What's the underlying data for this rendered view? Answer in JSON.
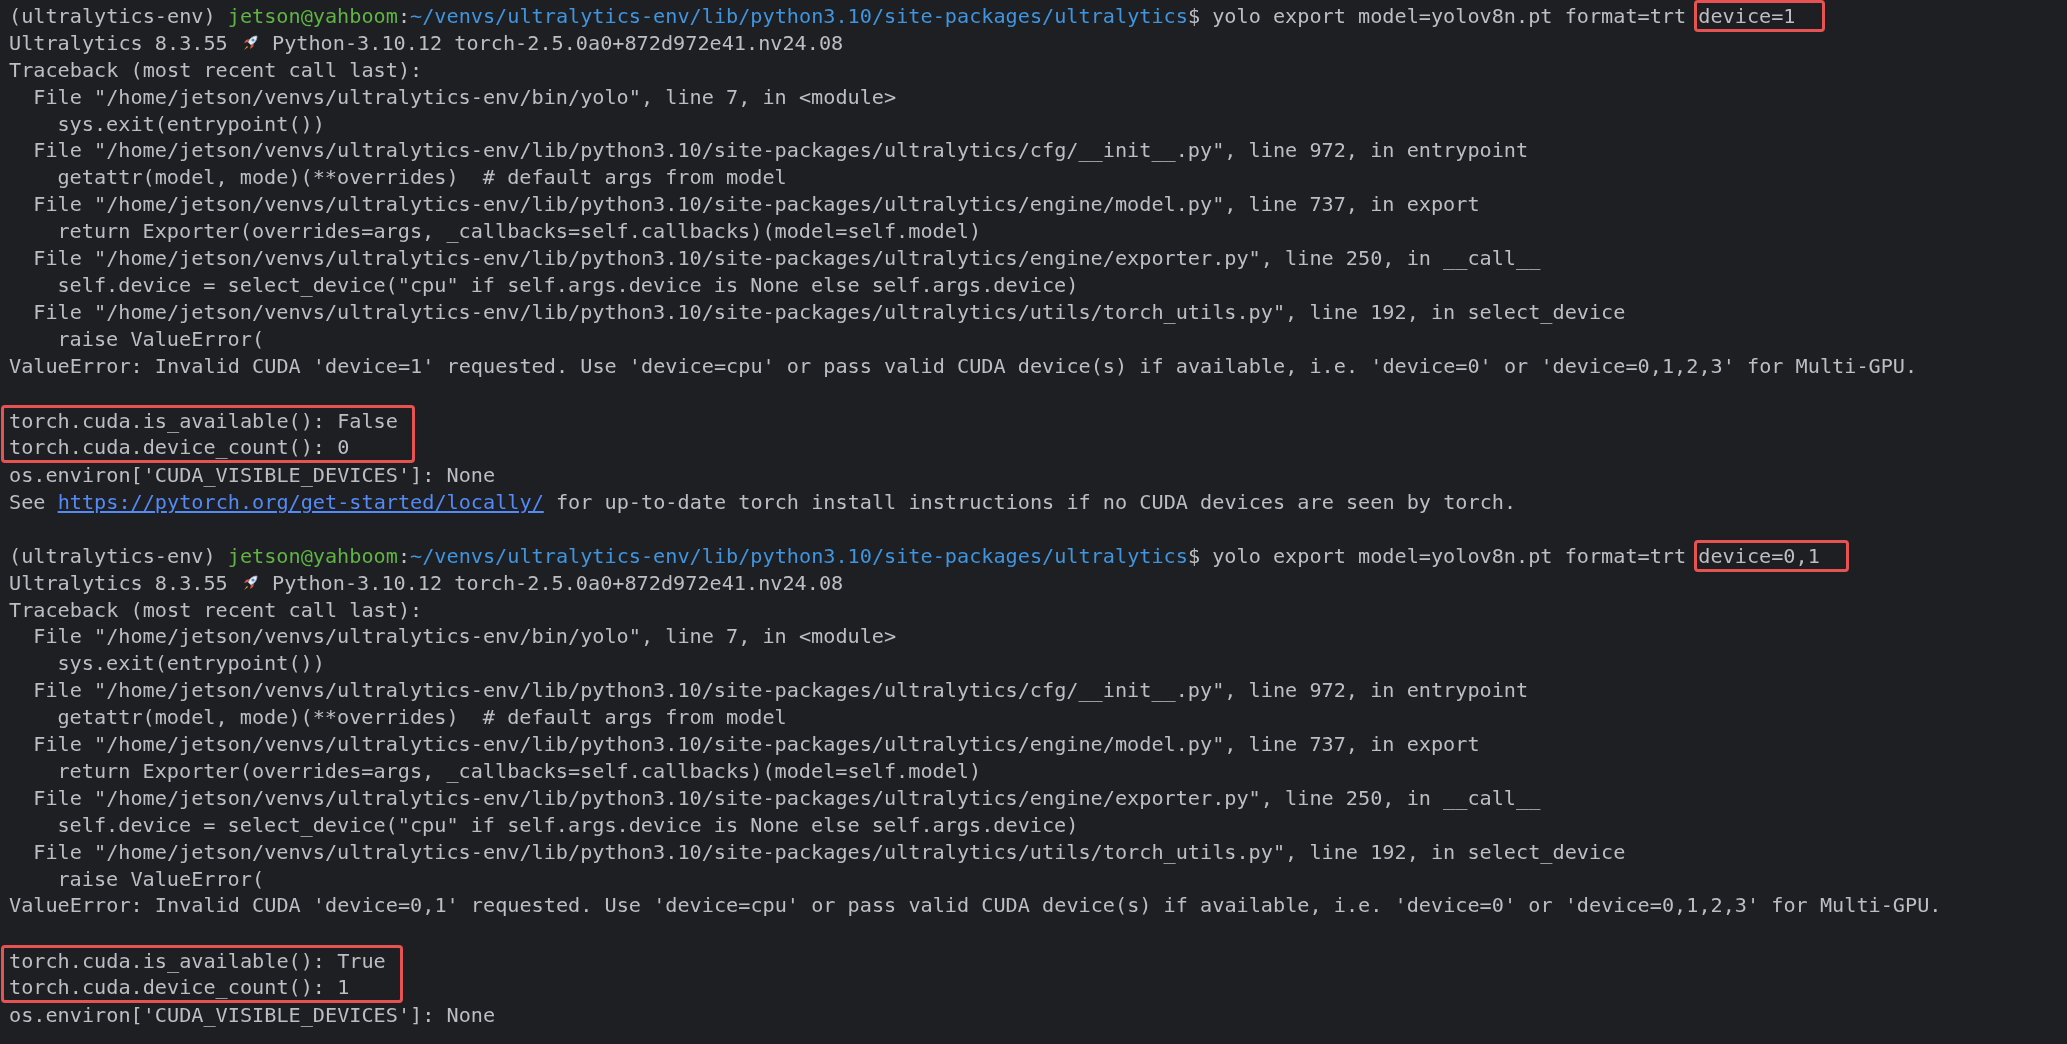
{
  "terminal": {
    "lines": [
      {
        "kind": "prompt",
        "env": "(ultralytics-env)",
        "user": "jetson@yahboom",
        "separator": ":",
        "path": "~/venvs/ultralytics-env/lib/python3.10/site-packages/ultralytics",
        "symbol": "$",
        "command": "yolo export model=yolov8n.pt format=trt",
        "highlight": "device=1"
      },
      {
        "kind": "version",
        "before": "Ultralytics 8.3.55",
        "after": "Python-3.10.12 torch-2.5.0a0+872d972e41.nv24.08"
      },
      {
        "kind": "text",
        "text": "Traceback (most recent call last):"
      },
      {
        "kind": "frame",
        "text": "File \"/home/jetson/venvs/ultralytics-env/bin/yolo\", line 7, in <module>"
      },
      {
        "kind": "code",
        "text": "sys.exit(entrypoint())"
      },
      {
        "kind": "frame",
        "text": "File \"/home/jetson/venvs/ultralytics-env/lib/python3.10/site-packages/ultralytics/cfg/__init__.py\", line 972, in entrypoint"
      },
      {
        "kind": "code",
        "text": "getattr(model, mode)(**overrides)  # default args from model"
      },
      {
        "kind": "frame",
        "text": "File \"/home/jetson/venvs/ultralytics-env/lib/python3.10/site-packages/ultralytics/engine/model.py\", line 737, in export"
      },
      {
        "kind": "code",
        "text": "return Exporter(overrides=args, _callbacks=self.callbacks)(model=self.model)"
      },
      {
        "kind": "frame",
        "text": "File \"/home/jetson/venvs/ultralytics-env/lib/python3.10/site-packages/ultralytics/engine/exporter.py\", line 250, in __call__"
      },
      {
        "kind": "code",
        "text": "self.device = select_device(\"cpu\" if self.args.device is None else self.args.device)"
      },
      {
        "kind": "frame",
        "text": "File \"/home/jetson/venvs/ultralytics-env/lib/python3.10/site-packages/ultralytics/utils/torch_utils.py\", line 192, in select_device"
      },
      {
        "kind": "code",
        "text": "raise ValueError("
      },
      {
        "kind": "text",
        "text": "ValueError: Invalid CUDA 'device=1' requested. Use 'device=cpu' or pass valid CUDA device(s) if available, i.e. 'device=0' or 'device=0,1,2,3' for Multi-GPU."
      },
      {
        "kind": "blank"
      },
      {
        "kind": "boxed",
        "lines": [
          "torch.cuda.is_available(): False",
          "torch.cuda.device_count(): 0"
        ]
      },
      {
        "kind": "text",
        "text": "os.environ['CUDA_VISIBLE_DEVICES']: None"
      },
      {
        "kind": "link",
        "before": "See",
        "url": "https://pytorch.org/get-started/locally/",
        "after": "for up-to-date torch install instructions if no CUDA devices are seen by torch."
      },
      {
        "kind": "blank"
      },
      {
        "kind": "prompt",
        "env": "(ultralytics-env)",
        "user": "jetson@yahboom",
        "separator": ":",
        "path": "~/venvs/ultralytics-env/lib/python3.10/site-packages/ultralytics",
        "symbol": "$",
        "command": "yolo export model=yolov8n.pt format=trt",
        "highlight": "device=0,1"
      },
      {
        "kind": "version",
        "before": "Ultralytics 8.3.55",
        "after": "Python-3.10.12 torch-2.5.0a0+872d972e41.nv24.08"
      },
      {
        "kind": "text",
        "text": "Traceback (most recent call last):"
      },
      {
        "kind": "frame",
        "text": "File \"/home/jetson/venvs/ultralytics-env/bin/yolo\", line 7, in <module>"
      },
      {
        "kind": "code",
        "text": "sys.exit(entrypoint())"
      },
      {
        "kind": "frame",
        "text": "File \"/home/jetson/venvs/ultralytics-env/lib/python3.10/site-packages/ultralytics/cfg/__init__.py\", line 972, in entrypoint"
      },
      {
        "kind": "code",
        "text": "getattr(model, mode)(**overrides)  # default args from model"
      },
      {
        "kind": "frame",
        "text": "File \"/home/jetson/venvs/ultralytics-env/lib/python3.10/site-packages/ultralytics/engine/model.py\", line 737, in export"
      },
      {
        "kind": "code",
        "text": "return Exporter(overrides=args, _callbacks=self.callbacks)(model=self.model)"
      },
      {
        "kind": "frame",
        "text": "File \"/home/jetson/venvs/ultralytics-env/lib/python3.10/site-packages/ultralytics/engine/exporter.py\", line 250, in __call__"
      },
      {
        "kind": "code",
        "text": "self.device = select_device(\"cpu\" if self.args.device is None else self.args.device)"
      },
      {
        "kind": "frame",
        "text": "File \"/home/jetson/venvs/ultralytics-env/lib/python3.10/site-packages/ultralytics/utils/torch_utils.py\", line 192, in select_device"
      },
      {
        "kind": "code",
        "text": "raise ValueError("
      },
      {
        "kind": "text",
        "text": "ValueError: Invalid CUDA 'device=0,1' requested. Use 'device=cpu' or pass valid CUDA device(s) if available, i.e. 'device=0' or 'device=0,1,2,3' for Multi-GPU."
      },
      {
        "kind": "blank"
      },
      {
        "kind": "boxed",
        "lines": [
          "torch.cuda.is_available(): True",
          "torch.cuda.device_count(): 1"
        ]
      },
      {
        "kind": "text",
        "text": "os.environ['CUDA_VISIBLE_DEVICES']: None"
      }
    ]
  }
}
